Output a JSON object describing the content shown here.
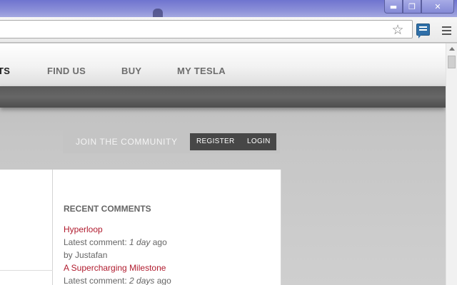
{
  "window": {
    "minimize_icon": "minimize-icon",
    "maximize_icon": "restore-icon",
    "close_icon": "close-icon",
    "min_glyph": "▬",
    "max_glyph": "❐",
    "close_glyph": "✕"
  },
  "toolbar": {
    "address_value": "",
    "star_glyph": "☆",
    "extension_icon": "comment-extension-icon",
    "menu_icon": "hamburger-menu-icon"
  },
  "nav": {
    "items": [
      {
        "label": "TS",
        "active": true
      },
      {
        "label": "FIND US",
        "active": false
      },
      {
        "label": "BUY",
        "active": false
      },
      {
        "label": "MY TESLA",
        "active": false
      }
    ]
  },
  "community": {
    "label": "JOIN THE COMMUNITY",
    "register": "REGISTER",
    "login": "LOGIN"
  },
  "recent_comments": {
    "title": "RECENT COMMENTS",
    "items": [
      {
        "title": "Hyperloop",
        "meta_prefix": "Latest comment: ",
        "when": "1 day",
        "meta_suffix": " ago",
        "author": "by Justafan"
      },
      {
        "title": "A Supercharging Milestone",
        "meta_prefix": "Latest comment: ",
        "when": "2 days",
        "meta_suffix": " ago"
      }
    ]
  },
  "colors": {
    "link": "#b01b2e",
    "titlebar": "#8b8fd8",
    "dark_bar": "#5a5a5a"
  }
}
